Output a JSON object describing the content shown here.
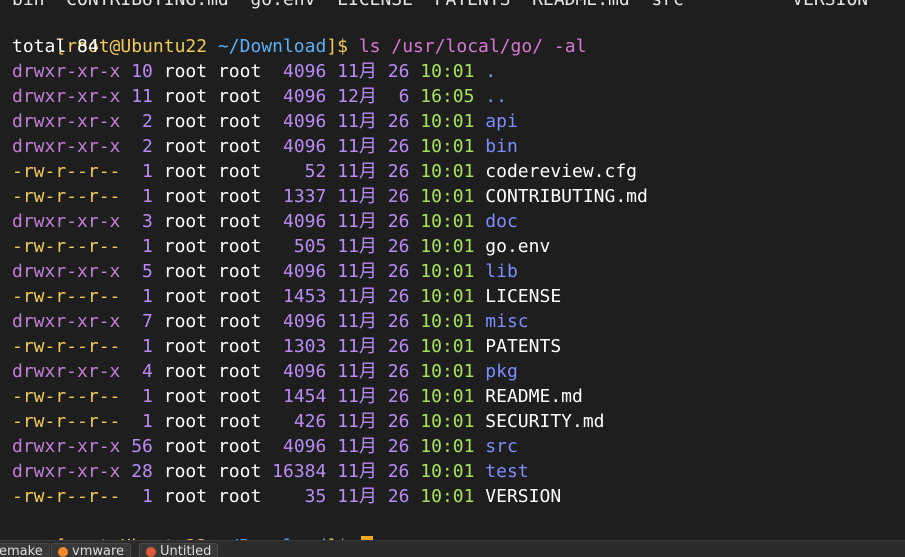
{
  "truncated_top": "bin  CONTRIBUTING.md  go.env  LICENSE  PATENTS  README.md  src          VERSION",
  "prompt": {
    "bracket_open": "[",
    "user": "root@Ubuntu22",
    "path": "~/Download",
    "bracket_close": "]$",
    "command": "ls /usr/local/go/ -al"
  },
  "total": "total 84",
  "entries": [
    {
      "perm": "drwxr-xr-x",
      "links": "10",
      "owner": "root",
      "group": "root",
      "size": "4096",
      "month": "11月",
      "day": "26",
      "time": "10:01",
      "name": ".",
      "is_dir": true
    },
    {
      "perm": "drwxr-xr-x",
      "links": "11",
      "owner": "root",
      "group": "root",
      "size": "4096",
      "month": "12月",
      "day": " 6",
      "time": "16:05",
      "name": "..",
      "is_dir": true
    },
    {
      "perm": "drwxr-xr-x",
      "links": " 2",
      "owner": "root",
      "group": "root",
      "size": "4096",
      "month": "11月",
      "day": "26",
      "time": "10:01",
      "name": "api",
      "is_dir": true
    },
    {
      "perm": "drwxr-xr-x",
      "links": " 2",
      "owner": "root",
      "group": "root",
      "size": "4096",
      "month": "11月",
      "day": "26",
      "time": "10:01",
      "name": "bin",
      "is_dir": true
    },
    {
      "perm": "-rw-r--r--",
      "links": " 1",
      "owner": "root",
      "group": "root",
      "size": "  52",
      "month": "11月",
      "day": "26",
      "time": "10:01",
      "name": "codereview.cfg",
      "is_dir": false
    },
    {
      "perm": "-rw-r--r--",
      "links": " 1",
      "owner": "root",
      "group": "root",
      "size": "1337",
      "month": "11月",
      "day": "26",
      "time": "10:01",
      "name": "CONTRIBUTING.md",
      "is_dir": false
    },
    {
      "perm": "drwxr-xr-x",
      "links": " 3",
      "owner": "root",
      "group": "root",
      "size": "4096",
      "month": "11月",
      "day": "26",
      "time": "10:01",
      "name": "doc",
      "is_dir": true
    },
    {
      "perm": "-rw-r--r--",
      "links": " 1",
      "owner": "root",
      "group": "root",
      "size": " 505",
      "month": "11月",
      "day": "26",
      "time": "10:01",
      "name": "go.env",
      "is_dir": false
    },
    {
      "perm": "drwxr-xr-x",
      "links": " 5",
      "owner": "root",
      "group": "root",
      "size": "4096",
      "month": "11月",
      "day": "26",
      "time": "10:01",
      "name": "lib",
      "is_dir": true
    },
    {
      "perm": "-rw-r--r--",
      "links": " 1",
      "owner": "root",
      "group": "root",
      "size": "1453",
      "month": "11月",
      "day": "26",
      "time": "10:01",
      "name": "LICENSE",
      "is_dir": false
    },
    {
      "perm": "drwxr-xr-x",
      "links": " 7",
      "owner": "root",
      "group": "root",
      "size": "4096",
      "month": "11月",
      "day": "26",
      "time": "10:01",
      "name": "misc",
      "is_dir": true
    },
    {
      "perm": "-rw-r--r--",
      "links": " 1",
      "owner": "root",
      "group": "root",
      "size": "1303",
      "month": "11月",
      "day": "26",
      "time": "10:01",
      "name": "PATENTS",
      "is_dir": false
    },
    {
      "perm": "drwxr-xr-x",
      "links": " 4",
      "owner": "root",
      "group": "root",
      "size": "4096",
      "month": "11月",
      "day": "26",
      "time": "10:01",
      "name": "pkg",
      "is_dir": true
    },
    {
      "perm": "-rw-r--r--",
      "links": " 1",
      "owner": "root",
      "group": "root",
      "size": "1454",
      "month": "11月",
      "day": "26",
      "time": "10:01",
      "name": "README.md",
      "is_dir": false
    },
    {
      "perm": "-rw-r--r--",
      "links": " 1",
      "owner": "root",
      "group": "root",
      "size": " 426",
      "month": "11月",
      "day": "26",
      "time": "10:01",
      "name": "SECURITY.md",
      "is_dir": false
    },
    {
      "perm": "drwxr-xr-x",
      "links": "56",
      "owner": "root",
      "group": "root",
      "size": "4096",
      "month": "11月",
      "day": "26",
      "time": "10:01",
      "name": "src",
      "is_dir": true
    },
    {
      "perm": "drwxr-xr-x",
      "links": "28",
      "owner": "root",
      "group": "root",
      "size": "16384",
      "month": "11月",
      "day": "26",
      "time": "10:01",
      "name": "test",
      "is_dir": true
    },
    {
      "perm": "-rw-r--r--",
      "links": " 1",
      "owner": "root",
      "group": "root",
      "size": "  35",
      "month": "11月",
      "day": "26",
      "time": "10:01",
      "name": "VERSION",
      "is_dir": false
    }
  ],
  "taskbar": [
    {
      "label": "emake",
      "icon": "",
      "color": "#dcdcdc"
    },
    {
      "label": "vmware",
      "icon": "circle",
      "color": "#f08c28"
    },
    {
      "label": "Untitled",
      "icon": "flame",
      "color": "#e05a3a"
    }
  ]
}
